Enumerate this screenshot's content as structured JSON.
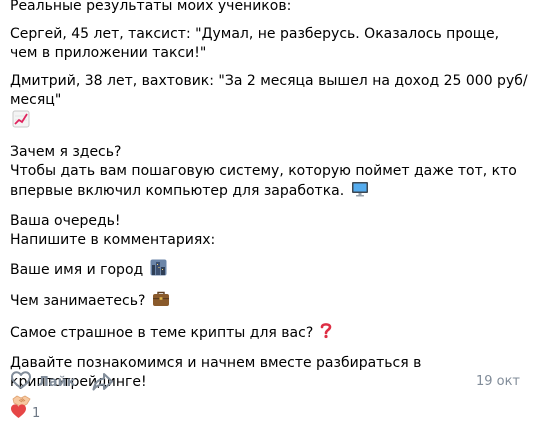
{
  "post": {
    "paragraphs": [
      {
        "text": "Реальные результаты моих учеников:"
      },
      {
        "text": "Сергей, 45 лет, таксист: \"Думал, не разберусь. Оказалось проще, чем в приложении такси!\""
      },
      {
        "text": "Дмитрий, 38 лет, вахтовик: \"За 2 месяца вышел на доход 25 000 руб/месяц\"",
        "emoji": "chart-increasing-icon"
      },
      {
        "line1": "Зачем я здесь?",
        "line2": "Чтобы дать вам пошаговую систему, которую поймет даже тот, кто впервые включил компьютер для заработка.",
        "emoji": "desktop-computer-icon"
      },
      {
        "line1": "Ваша очередь!",
        "line2": "Напишите в комментариях:"
      },
      {
        "text": "Ваше имя и город",
        "emoji": "cityscape-icon"
      },
      {
        "text": "Чем занимаетесь?",
        "emoji": "briefcase-icon"
      },
      {
        "text": "Самое страшное в теме крипты для вас?",
        "emoji": "red-question-mark-icon"
      },
      {
        "text": "Давайте познакомимся и начнем вместе разбираться в криптотрейдинге!",
        "emoji": "handshake-icon"
      }
    ]
  },
  "actions": {
    "like_label": "Лайк",
    "like_icon": "heart-outline-icon",
    "share_icon": "share-arrow-icon",
    "date": "19 окт"
  },
  "reactions": {
    "icon": "heart-reaction-icon",
    "count": "1"
  },
  "colors": {
    "text": "#000000",
    "muted": "#818c99",
    "heart": "#e64646"
  }
}
